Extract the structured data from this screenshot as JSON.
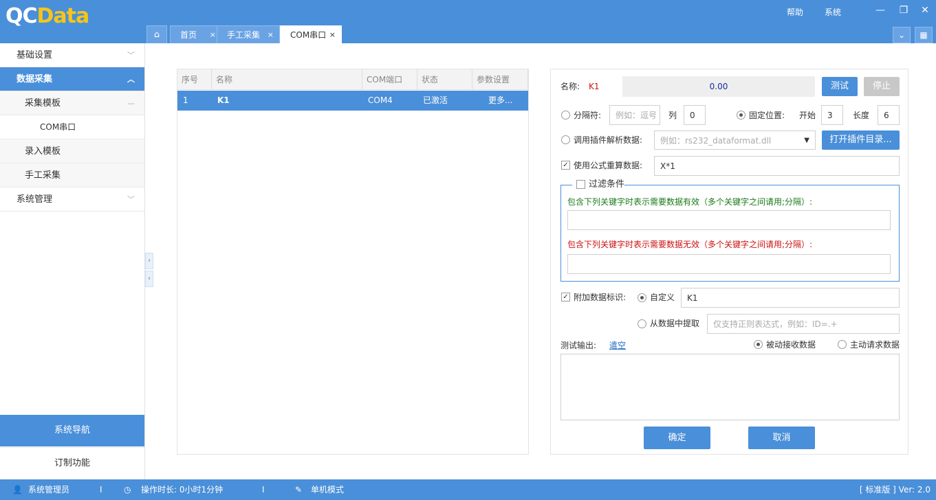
{
  "app": {
    "logo_qc": "QC",
    "logo_data": "Data"
  },
  "topbar": {
    "help": "帮助",
    "system": "系统"
  },
  "tabs": [
    {
      "label": "首页"
    },
    {
      "label": "手工采集"
    },
    {
      "label": "COM串口"
    }
  ],
  "tab_close": "×",
  "sidebar": {
    "items": [
      {
        "label": "基础设置"
      },
      {
        "label": "数据采集"
      },
      {
        "label": "采集模板"
      },
      {
        "label": "COM串口"
      },
      {
        "label": "录入模板"
      },
      {
        "label": "手工采集"
      },
      {
        "label": "系统管理"
      }
    ],
    "nav": "系统导航",
    "custom": "订制功能"
  },
  "table": {
    "headers": [
      "序号",
      "名称",
      "COM端口",
      "状态",
      "参数设置"
    ],
    "rows": [
      {
        "no": "1",
        "name": "K1",
        "port": "COM4",
        "status": "已激活",
        "settings": "更多..."
      }
    ]
  },
  "form": {
    "name_label": "名称:",
    "name_value": "K1",
    "display_value": "0.00",
    "test_btn": "测试",
    "stop_btn": "停止",
    "separator_label": "分隔符:",
    "separator_placeholder": "例如：逗号",
    "col_label": "列",
    "col_value": "0",
    "fixed_label": "固定位置:",
    "start_label": "开始",
    "start_value": "3",
    "length_label": "长度",
    "length_value": "6",
    "plugin_label": "调用插件解析数据:",
    "plugin_placeholder": "例如：rs232_dataformat.dll",
    "plugin_btn": "打开插件目录...",
    "formula_label": "使用公式重算数据:",
    "formula_value": "X*1",
    "filter_title": "过滤条件",
    "filter_valid": "包含下列关键字时表示需要数据有效（多个关键字之间请用;分隔）:",
    "filter_invalid": "包含下列关键字时表示需要数据无效（多个关键字之间请用;分隔）:",
    "tag_label": "附加数据标识:",
    "custom_label": "自定义",
    "custom_value": "K1",
    "extract_label": "从数据中提取",
    "extract_placeholder": "仅支持正则表达式，例如：ID=.+",
    "output_label": "测试输出:",
    "clear_link": "遣空",
    "passive_label": "被动接收数据",
    "active_label": "主动请求数据",
    "ok_btn": "确定",
    "cancel_btn": "取消"
  },
  "status": {
    "user": "系统管理员",
    "duration": "操作时长: 0小时1分钟",
    "mode": "单机模式",
    "version": "[ 标准版 ] Ver: 2.0",
    "sep": "I"
  },
  "colors": {
    "accent": "#4a8fd9",
    "logo_yellow": "#f5c518",
    "valid_text": "#1a7a1a",
    "invalid_text": "#cc1111"
  }
}
